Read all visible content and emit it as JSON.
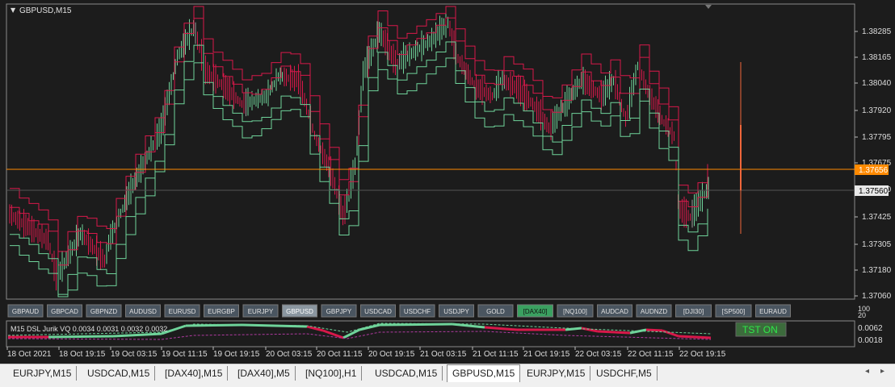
{
  "chart": {
    "symbol_title": "GBPUSD,M15",
    "price_levels": [
      "1.38285",
      "1.38165",
      "1.38040",
      "1.37920",
      "1.37795",
      "1.37675",
      "1.37550",
      "1.37425",
      "1.37305",
      "1.37180",
      "1.37060"
    ],
    "current_price_orange": "1.37656",
    "current_price_white": "1.37560",
    "colors": {
      "bull": "#6fd39a",
      "bear": "#d8184a",
      "neutral": "#9a9a9a",
      "envelope_red": "#d8184a",
      "envelope_green": "#6fd39a",
      "orange": "#ff8a00",
      "bg": "#1c1c1c"
    }
  },
  "symbol_buttons": [
    "GBPAUD",
    "GBPCAD",
    "GBPNZD",
    "AUDUSD",
    "EURUSD",
    "EURGBP",
    "EURJPY",
    "GBPUSD",
    "GBPJPY",
    "USDCAD",
    "USDCHF",
    "USDJPY",
    "GOLD",
    "[DAX40]",
    "[NQ100]",
    "AUDCAD",
    "AUDNZD",
    "[DJI30]",
    "[SP500]",
    "EURAUD"
  ],
  "active_symbol_button": "GBPUSD",
  "highlight_symbol_button": "[DAX40]",
  "indicator": {
    "label": "M15 DSL Jurik VQ 0.0034 0.0031 0.0032 0.0032",
    "scale": [
      "100",
      "20",
      "0.0062",
      "0.0018"
    ],
    "tst_button": "TST ON"
  },
  "time_labels": [
    "18 Oct 2021",
    "18 Oct 19:15",
    "19 Oct 03:15",
    "19 Oct 11:15",
    "19 Oct 19:15",
    "20 Oct 03:15",
    "20 Oct 11:15",
    "20 Oct 19:15",
    "21 Oct 03:15",
    "21 Oct 11:15",
    "21 Oct 19:15",
    "22 Oct 03:15",
    "22 Oct 11:15",
    "22 Oct 19:15"
  ],
  "bottom_tabs": [
    "EURJPY,M15",
    "USDCAD,M15",
    "[DAX40],M15",
    "[DAX40],M5",
    "[NQ100],H1",
    "USDCAD,M15",
    "GBPUSD,M15",
    "EURJPY,M15",
    "USDCHF,M5"
  ],
  "active_bottom_tab": "GBPUSD,M15",
  "nav": {
    "left": "◂",
    "right": "▸"
  }
}
